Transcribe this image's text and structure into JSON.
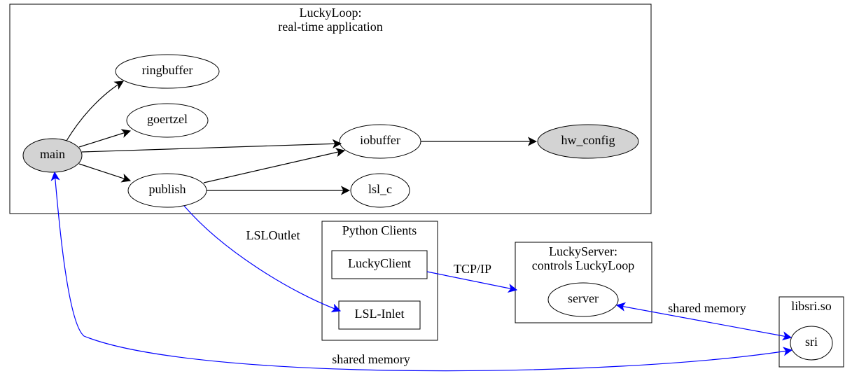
{
  "clusters": {
    "luckyloop": {
      "title_line1": "LuckyLoop:",
      "title_line2": "real-time application"
    },
    "pyclients": {
      "title": "Python Clients"
    },
    "luckyserver": {
      "title_line1": "LuckyServer:",
      "title_line2": "controls LuckyLoop"
    },
    "libsri": {
      "title": "libsri.so"
    }
  },
  "nodes": {
    "main": {
      "label": "main"
    },
    "ringbuffer": {
      "label": "ringbuffer"
    },
    "goertzel": {
      "label": "goertzel"
    },
    "publish": {
      "label": "publish"
    },
    "iobuffer": {
      "label": "iobuffer"
    },
    "lsl_c": {
      "label": "lsl_c"
    },
    "hw_config": {
      "label": "hw_config"
    },
    "luckyclient": {
      "label": "LuckyClient"
    },
    "lsl_inlet": {
      "label": "LSL-Inlet"
    },
    "server": {
      "label": "server"
    },
    "sri": {
      "label": "sri"
    }
  },
  "edge_labels": {
    "lsloutlet": "LSLOutlet",
    "tcpip": "TCP/IP",
    "sharedmem1": "shared memory",
    "sharedmem2": "shared memory"
  },
  "chart_data": {
    "type": "graph",
    "directed": true,
    "clusters": [
      {
        "id": "luckyloop",
        "label": "LuckyLoop: real-time application",
        "nodes": [
          "main",
          "ringbuffer",
          "goertzel",
          "publish",
          "iobuffer",
          "lsl_c",
          "hw_config"
        ]
      },
      {
        "id": "pyclients",
        "label": "Python Clients",
        "nodes": [
          "luckyclient",
          "lsl_inlet"
        ]
      },
      {
        "id": "luckyserver",
        "label": "LuckyServer: controls LuckyLoop",
        "nodes": [
          "server"
        ]
      },
      {
        "id": "libsri",
        "label": "libsri.so",
        "nodes": [
          "sri"
        ]
      }
    ],
    "nodes": [
      {
        "id": "main",
        "label": "main",
        "shape": "ellipse",
        "filled": true
      },
      {
        "id": "ringbuffer",
        "label": "ringbuffer",
        "shape": "ellipse",
        "filled": false
      },
      {
        "id": "goertzel",
        "label": "goertzel",
        "shape": "ellipse",
        "filled": false
      },
      {
        "id": "publish",
        "label": "publish",
        "shape": "ellipse",
        "filled": false
      },
      {
        "id": "iobuffer",
        "label": "iobuffer",
        "shape": "ellipse",
        "filled": false
      },
      {
        "id": "lsl_c",
        "label": "lsl_c",
        "shape": "ellipse",
        "filled": false
      },
      {
        "id": "hw_config",
        "label": "hw_config",
        "shape": "ellipse",
        "filled": true
      },
      {
        "id": "luckyclient",
        "label": "LuckyClient",
        "shape": "box",
        "filled": false
      },
      {
        "id": "lsl_inlet",
        "label": "LSL-Inlet",
        "shape": "box",
        "filled": false
      },
      {
        "id": "server",
        "label": "server",
        "shape": "ellipse",
        "filled": false
      },
      {
        "id": "sri",
        "label": "sri",
        "shape": "ellipse",
        "filled": false
      }
    ],
    "edges": [
      {
        "from": "main",
        "to": "ringbuffer",
        "color": "black",
        "label": null
      },
      {
        "from": "main",
        "to": "goertzel",
        "color": "black",
        "label": null
      },
      {
        "from": "main",
        "to": "iobuffer",
        "color": "black",
        "label": null
      },
      {
        "from": "main",
        "to": "publish",
        "color": "black",
        "label": null
      },
      {
        "from": "publish",
        "to": "iobuffer",
        "color": "black",
        "label": null
      },
      {
        "from": "publish",
        "to": "lsl_c",
        "color": "black",
        "label": null
      },
      {
        "from": "iobuffer",
        "to": "hw_config",
        "color": "black",
        "label": null
      },
      {
        "from": "publish",
        "to": "lsl_inlet",
        "color": "blue",
        "label": "LSLOutlet"
      },
      {
        "from": "luckyclient",
        "to": "server",
        "color": "blue",
        "label": "TCP/IP"
      },
      {
        "from": "server",
        "to": "sri",
        "color": "blue",
        "label": "shared memory",
        "bidirectional": true
      },
      {
        "from": "sri",
        "to": "main",
        "color": "blue",
        "label": "shared memory",
        "bidirectional": true
      }
    ]
  }
}
